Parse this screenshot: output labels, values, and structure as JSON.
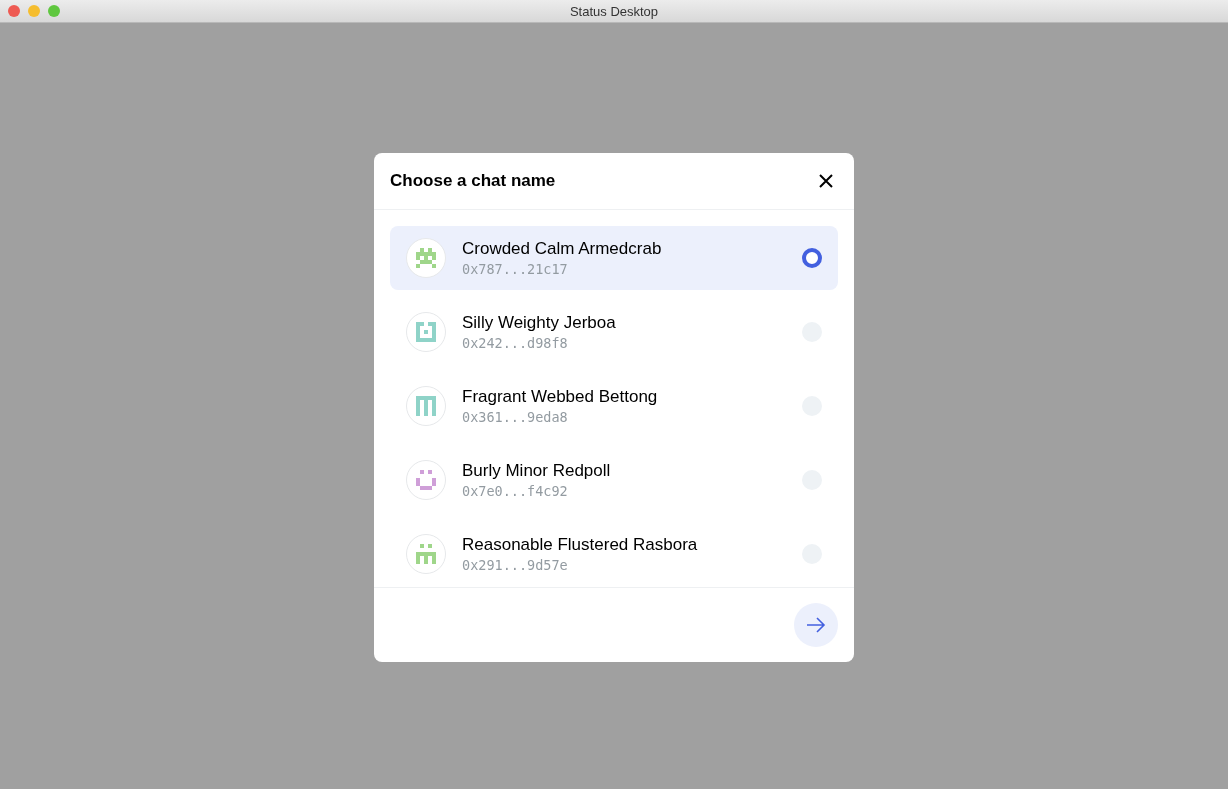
{
  "window": {
    "title": "Status Desktop"
  },
  "dialog": {
    "title": "Choose a chat name",
    "options": [
      {
        "name": "Crowded Calm Armedcrab",
        "address": "0x787...21c17",
        "color": "#9fd68a",
        "selected": true
      },
      {
        "name": "Silly Weighty Jerboa",
        "address": "0x242...d98f8",
        "color": "#8fd3c8",
        "selected": false
      },
      {
        "name": "Fragrant Webbed Bettong",
        "address": "0x361...9eda8",
        "color": "#8fd3c8",
        "selected": false
      },
      {
        "name": "Burly Minor Redpoll",
        "address": "0x7e0...f4c92",
        "color": "#cf9fd8",
        "selected": false
      },
      {
        "name": "Reasonable Flustered Rasbora",
        "address": "0x291...9d57e",
        "color": "#9fd68a",
        "selected": false
      }
    ]
  }
}
